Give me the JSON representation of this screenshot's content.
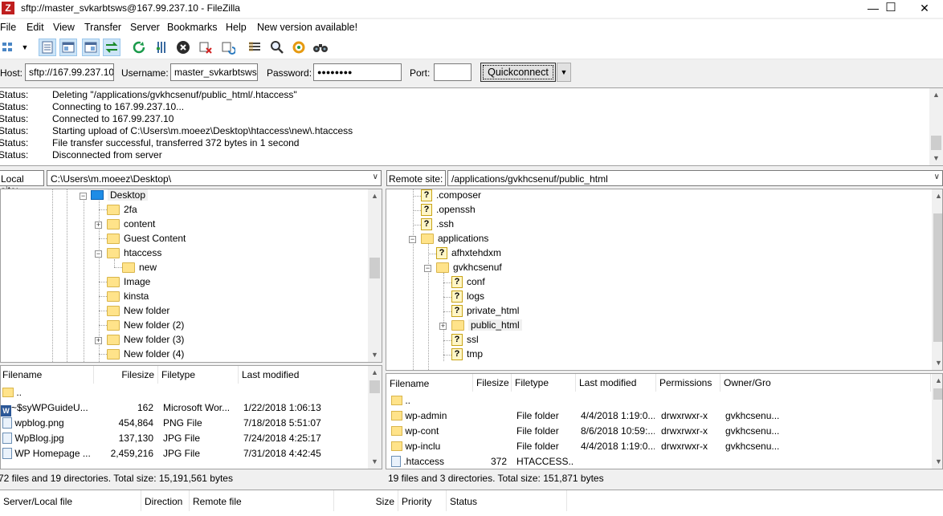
{
  "window": {
    "title": "sftp://master_svkarbtsws@167.99.237.10 - FileZilla",
    "app_icon": "Z",
    "controls": [
      "—",
      "☐",
      "✕"
    ]
  },
  "menu": [
    "File",
    "Edit",
    "View",
    "Transfer",
    "Server",
    "Bookmarks",
    "Help",
    "New version available!"
  ],
  "toolbar": {
    "icons": [
      "site-manager-icon",
      "toggle-message-log-icon",
      "toggle-local-tree-icon",
      "toggle-remote-tree-icon",
      "toggle-queue-icon",
      "refresh-icon",
      "process-queue-icon",
      "cancel-icon",
      "disconnect-icon",
      "reconnect-icon",
      "directory-listing-filters-icon",
      "compare-icon",
      "sync-browse-icon",
      "search-icon"
    ]
  },
  "quickconnect": {
    "host_label": "Host:",
    "host_value": "sftp://167.99.237.10",
    "username_label": "Username:",
    "username_value": "master_svkarbtsws",
    "password_label": "Password:",
    "password_value": "●●●●●●●●",
    "port_label": "Port:",
    "port_value": "",
    "button": "Quickconnect",
    "arrow": "▼"
  },
  "log": [
    {
      "k": "Status:",
      "v": "Deleting \"/applications/gvkhcsenuf/public_html/.htaccess\""
    },
    {
      "k": "Status:",
      "v": "Connecting to 167.99.237.10..."
    },
    {
      "k": "Status:",
      "v": "Connected to 167.99.237.10"
    },
    {
      "k": "Status:",
      "v": "Starting upload of C:\\Users\\m.moeez\\Desktop\\htaccess\\new\\.htaccess"
    },
    {
      "k": "Status:",
      "v": "File transfer successful, transferred 372 bytes in 1 second"
    },
    {
      "k": "Status:",
      "v": "Disconnected from server"
    }
  ],
  "local": {
    "label": "Local site:",
    "path": "C:\\Users\\m.moeez\\Desktop\\",
    "tree": [
      "Desktop",
      "2fa",
      "content",
      "Guest Content",
      "htaccess",
      "new",
      "Image",
      "kinsta",
      "New folder",
      "New folder (2)",
      "New folder (3)",
      "New folder (4)"
    ],
    "columns": [
      "Filename",
      "Filesize",
      "Filetype",
      "Last modified"
    ],
    "files": [
      {
        "name": "..",
        "size": "",
        "type": "",
        "modified": ""
      },
      {
        "name": "~$syWPGuideU...",
        "size": "162",
        "type": "Microsoft Wor...",
        "modified": "1/22/2018 1:06:13"
      },
      {
        "name": "wpblog.png",
        "size": "454,864",
        "type": "PNG File",
        "modified": "7/18/2018 5:51:07"
      },
      {
        "name": "WpBlog.jpg",
        "size": "137,130",
        "type": "JPG File",
        "modified": "7/24/2018 4:25:17"
      },
      {
        "name": "WP Homepage ...",
        "size": "2,459,216",
        "type": "JPG File",
        "modified": "7/31/2018 4:42:45"
      }
    ],
    "status": "72 files and 19 directories. Total size: 15,191,561 bytes"
  },
  "remote": {
    "label": "Remote site:",
    "path": "/applications/gvkhcsenuf/public_html",
    "tree": [
      ".composer",
      ".openssh",
      ".ssh",
      "applications",
      "afhxtehdxm",
      "gvkhcsenuf",
      "conf",
      "logs",
      "private_html",
      "public_html",
      "ssl",
      "tmp"
    ],
    "columns": [
      "Filename",
      "Filesize",
      "Filetype",
      "Last modified",
      "Permissions",
      "Owner/Gro"
    ],
    "files": [
      {
        "name": "..",
        "size": "",
        "type": "",
        "modified": "",
        "perm": "",
        "owner": ""
      },
      {
        "name": "wp-admin",
        "size": "",
        "type": "File folder",
        "modified": "4/4/2018 1:19:0...",
        "perm": "drwxrwxr-x",
        "owner": "gvkhcsenu..."
      },
      {
        "name": "wp-cont",
        "size": "",
        "type": "File folder",
        "modified": "8/6/2018 10:59:...",
        "perm": "drwxrwxr-x",
        "owner": "gvkhcsenu..."
      },
      {
        "name": "wp-inclu",
        "size": "",
        "type": "File folder",
        "modified": "4/4/2018 1:19:0...",
        "perm": "drwxrwxr-x",
        "owner": "gvkhcsenu..."
      },
      {
        "name": ".htaccess",
        "size": "372",
        "type": "HTACCESS...",
        "modified": "",
        "perm": "",
        "owner": ""
      }
    ],
    "status": "19 files and 3 directories. Total size: 151,871 bytes"
  },
  "queue": {
    "columns": [
      "Server/Local file",
      "Direction",
      "Remote file",
      "Size",
      "Priority",
      "Status"
    ]
  }
}
